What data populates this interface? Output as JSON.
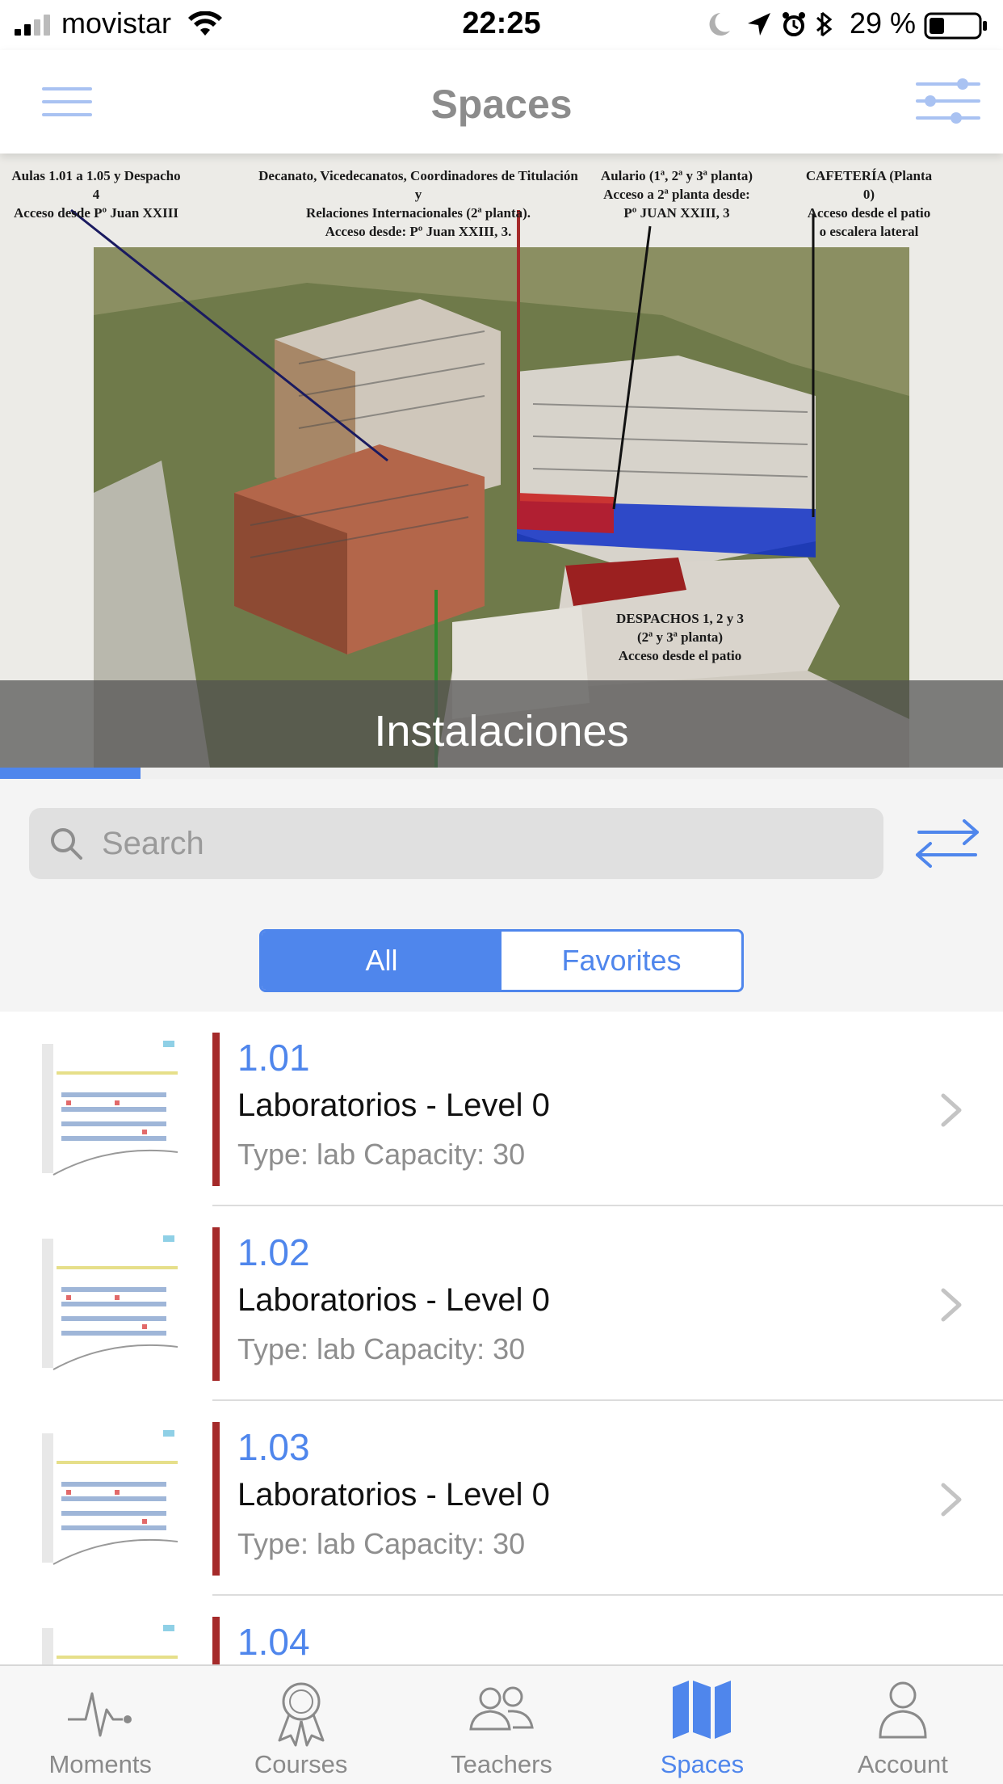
{
  "status_bar": {
    "carrier": "movistar",
    "time": "22:25",
    "battery_percent": "29 %",
    "icons": [
      "signal-icon",
      "wifi-icon",
      "moon-icon",
      "location-arrow-icon",
      "alarm-icon",
      "bluetooth-icon",
      "battery-icon"
    ]
  },
  "nav": {
    "title": "Spaces",
    "left_icon": "menu-icon",
    "right_icon": "filter-sliders-icon"
  },
  "hero": {
    "caption": "Instalaciones",
    "labels": [
      "Aulas 1.01 a 1.05 y Despacho 4\nAcceso desde Pº Juan XXIII",
      "Decanato, Vicedecanatos, Coordinadores de Titulación y\nRelaciones Internacionales (2ª planta).\nAcceso desde: Pº Juan XXIII, 3.",
      "Aulario (1ª, 2ª y 3ª planta)\nAcceso a 2ª planta desde:\nPº JUAN XXIII, 3",
      "CAFETERÍA (Planta 0)\nAcceso desde el patio\no escalera lateral",
      "DESPACHOS 1, 2 y 3\n(2ª y 3ª planta)\nAcceso desde el patio"
    ],
    "carousel_progress": 0.14
  },
  "search": {
    "placeholder": "Search",
    "value": ""
  },
  "segments": {
    "all": "All",
    "favorites": "Favorites",
    "selected": "All"
  },
  "spaces": [
    {
      "code": "1.01",
      "name": "Laboratorios - Level 0",
      "meta": "Type: lab Capacity: 30"
    },
    {
      "code": "1.02",
      "name": "Laboratorios - Level 0",
      "meta": "Type: lab Capacity: 30"
    },
    {
      "code": "1.03",
      "name": "Laboratorios - Level 0",
      "meta": "Type: lab Capacity: 30"
    },
    {
      "code": "1.04",
      "name": "",
      "meta": ""
    }
  ],
  "tabs": [
    {
      "label": "Moments",
      "icon": "heartbeat-icon"
    },
    {
      "label": "Courses",
      "icon": "award-ribbon-icon"
    },
    {
      "label": "Teachers",
      "icon": "people-icon"
    },
    {
      "label": "Spaces",
      "icon": "map-icon"
    },
    {
      "label": "Account",
      "icon": "user-icon"
    }
  ],
  "colors": {
    "accent": "#4f86ec",
    "row_marker": "#a52a2a",
    "nav_title": "#8c8c8c"
  }
}
